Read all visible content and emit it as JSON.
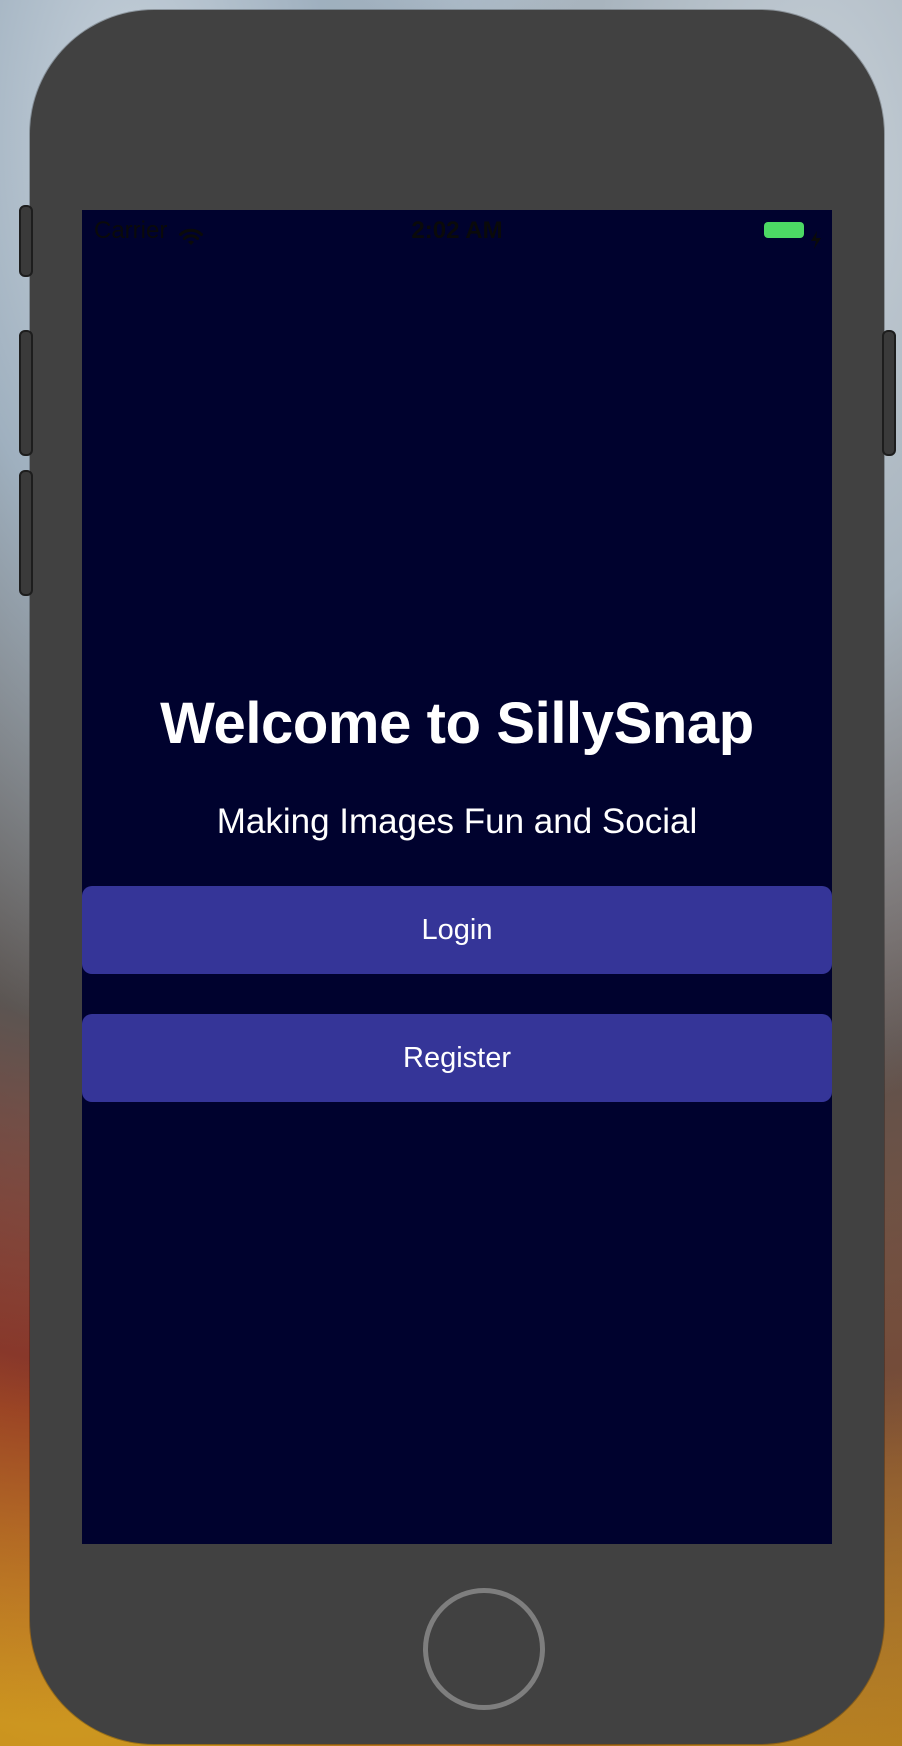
{
  "status_bar": {
    "carrier": "Carrier",
    "time": "2:02 AM",
    "icons": [
      "wifi-icon",
      "battery-icon",
      "charging-bolt-icon"
    ],
    "battery_color": "#4cd964"
  },
  "welcome": {
    "title": "Welcome to SillySnap",
    "subtitle": "Making Images Fun and Social"
  },
  "buttons": {
    "login_label": "Login",
    "register_label": "Register"
  },
  "colors": {
    "screen_background": "#00022e",
    "button_background": "#353598",
    "text": "#ffffff",
    "device_frame": "#414141"
  }
}
